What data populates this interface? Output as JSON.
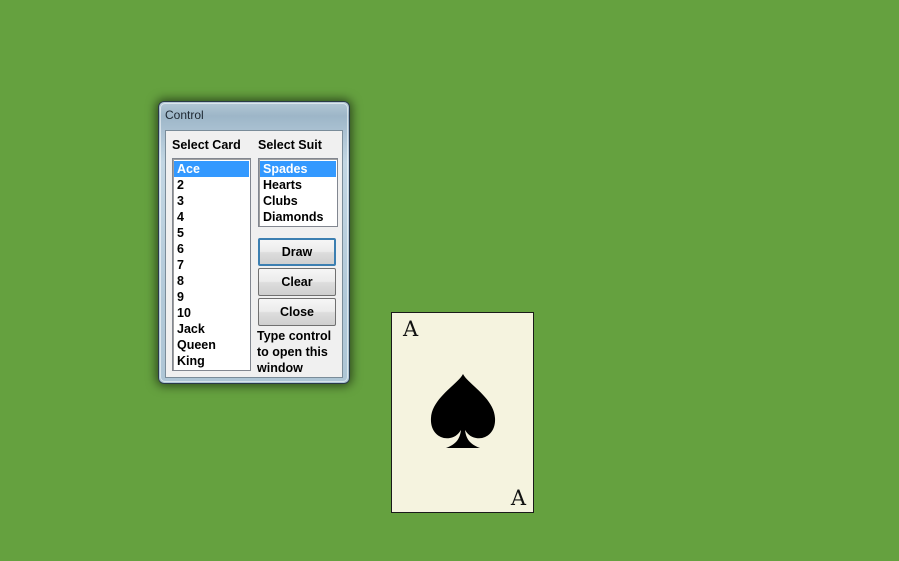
{
  "window": {
    "title": "Control"
  },
  "card_list": {
    "label": "Select Card",
    "items": [
      "Ace",
      "2",
      "3",
      "4",
      "5",
      "6",
      "7",
      "8",
      "9",
      "10",
      "Jack",
      "Queen",
      "King"
    ],
    "selected": "Ace"
  },
  "suit_list": {
    "label": "Select Suit",
    "items": [
      "Spades",
      "Hearts",
      "Clubs",
      "Diamonds"
    ],
    "selected": "Spades"
  },
  "buttons": {
    "draw": "Draw",
    "clear": "Clear",
    "close": "Close"
  },
  "hint": "Type control to open this window",
  "card": {
    "rank_top": "A",
    "rank_bottom": "A",
    "suit_icon": "spade-icon"
  },
  "colors": {
    "desktop": "#65a13f",
    "selection": "#3399ff",
    "card_face": "#f5f3df"
  }
}
